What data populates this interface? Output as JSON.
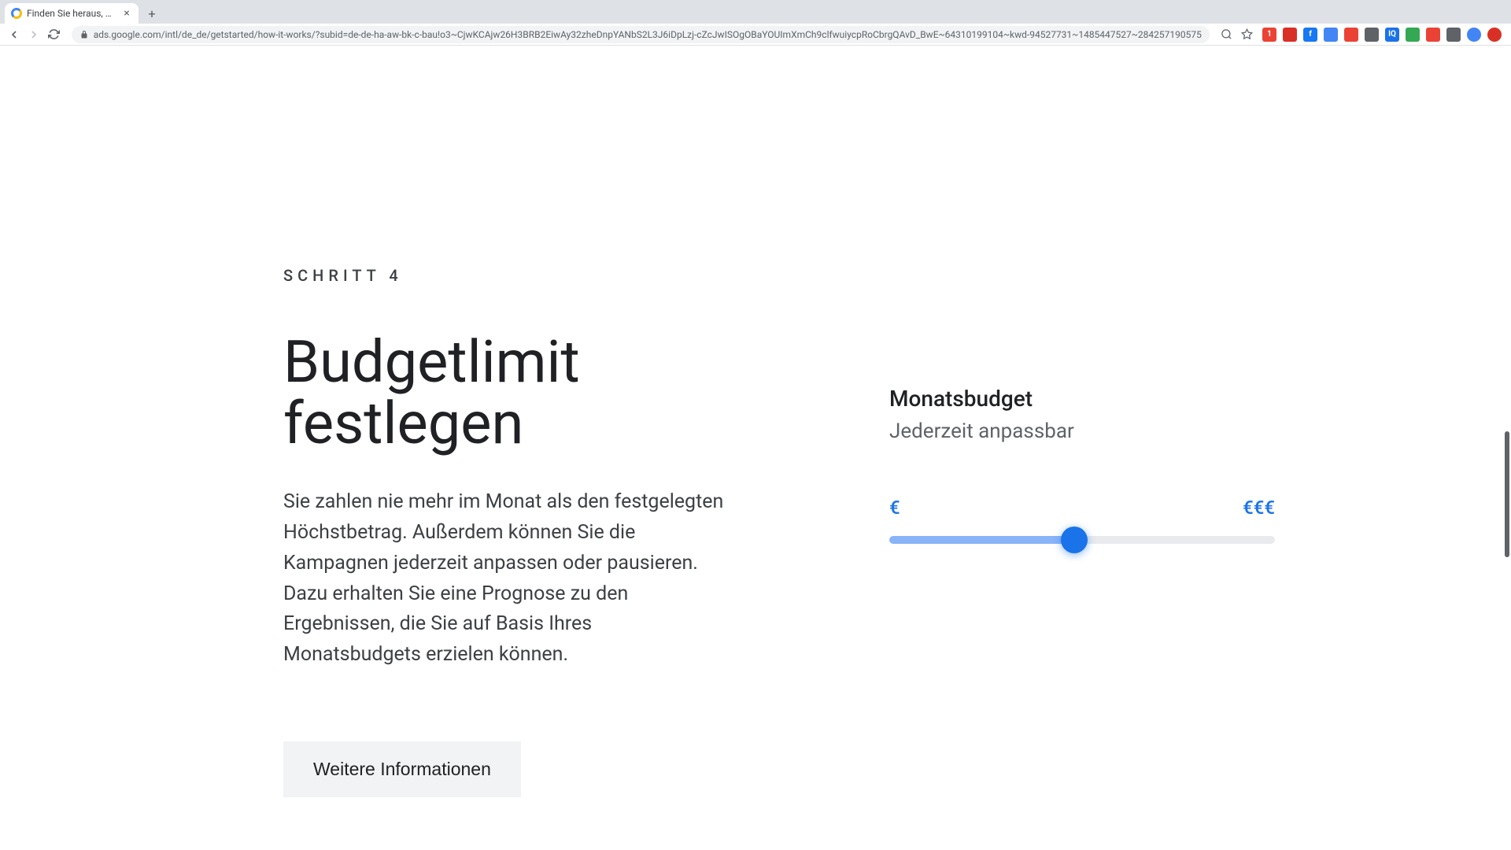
{
  "browser": {
    "tab_title": "Finden Sie heraus, wie Sie mi",
    "url_display": "ads.google.com/intl/de_de/getstarted/how-it-works/?subid=de-de-ha-aw-bk-c-bau!o3~CjwKCAjw26H3BRB2EiwAy32zheDnpYANbS2L3J6iDpLzj-cZcJwISOgOBaYOUImXmCh9clfwuiycpRoCbrgQAvD_BwE~64310199104~kwd-94527731~1485447527~284257190575",
    "url_domain": "ads.google.com"
  },
  "content": {
    "step_label": "SCHRITT 4",
    "heading": "Budgetlimit festlegen",
    "description": "Sie zahlen nie mehr im Monat als den festgelegten Höchstbetrag. Außerdem können Sie die Kampagnen jederzeit anpassen oder pausieren. Dazu erhalten Sie eine Prognose zu den Ergebnissen, die Sie auf Basis Ihres Monatsbudgets erzielen können.",
    "more_button": "Weitere Informationen"
  },
  "widget": {
    "title": "Monatsbudget",
    "subtitle": "Jederzeit anpassbar",
    "slider_min": "€",
    "slider_max": "€€€",
    "slider_percent": 48
  }
}
